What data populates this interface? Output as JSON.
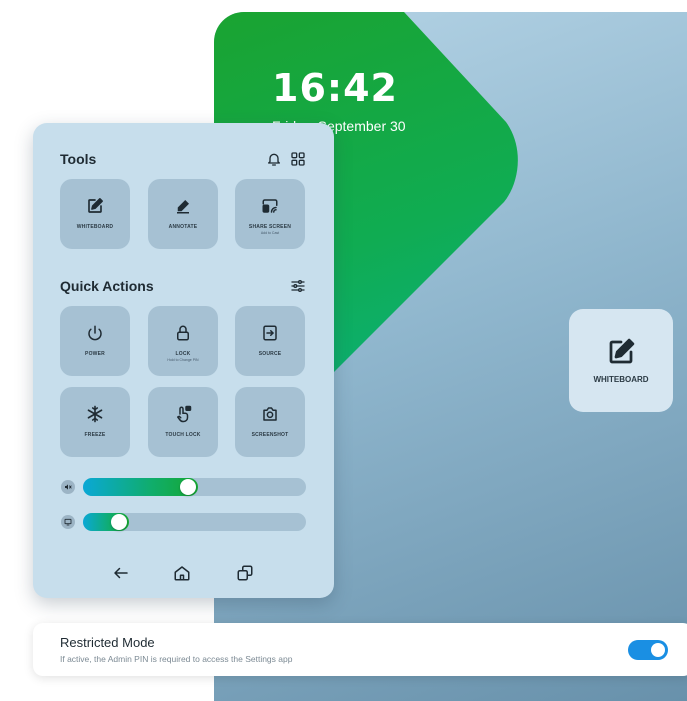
{
  "lockscreen": {
    "time": "16:42",
    "date": "Friday, September 30"
  },
  "floating_widget": {
    "label": "WHITEBOARD",
    "icon": "whiteboard-icon"
  },
  "panel": {
    "tools_title": "Tools",
    "tools": [
      {
        "label": "WHITEBOARD",
        "sub": "",
        "icon": "whiteboard-icon"
      },
      {
        "label": "ANNOTATE",
        "sub": "",
        "icon": "pen-icon"
      },
      {
        "label": "SHARE SCREEN",
        "sub": "Add to Cast",
        "icon": "cast-icon"
      }
    ],
    "quick_title": "Quick Actions",
    "actions": [
      {
        "label": "POWER",
        "sub": "",
        "icon": "power-icon"
      },
      {
        "label": "LOCK",
        "sub": "Hold to Change PIN",
        "icon": "lock-icon"
      },
      {
        "label": "SOURCE",
        "sub": "",
        "icon": "source-icon"
      },
      {
        "label": "FREEZE",
        "sub": "",
        "icon": "snowflake-icon"
      },
      {
        "label": "TOUCH LOCK",
        "sub": "",
        "icon": "touch-lock-icon"
      },
      {
        "label": "SCREENSHOT",
        "sub": "",
        "icon": "camera-icon"
      }
    ],
    "sliders": [
      {
        "name": "volume",
        "value_fraction": 0.47
      },
      {
        "name": "brightness",
        "value_fraction": 0.16
      }
    ]
  },
  "restricted_mode": {
    "title": "Restricted Mode",
    "description": "If active, the Admin PIN is required to access the Settings app",
    "enabled": true
  },
  "colors": {
    "accent_green": "#16a832",
    "accent_blue": "#1a8fe3",
    "panel_bg": "#c7deec",
    "tile_bg": "#a6c1d3"
  }
}
